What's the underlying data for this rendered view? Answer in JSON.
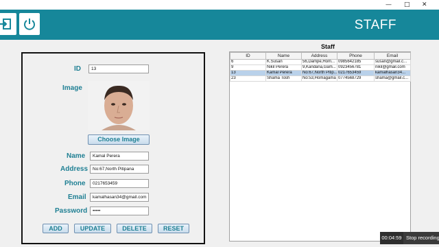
{
  "window": {
    "minimize": "—",
    "maximize": "□",
    "close": "✕"
  },
  "header": {
    "title": "STAFF"
  },
  "form": {
    "id_label": "ID",
    "id_value": "13",
    "image_label": "Image",
    "choose_image": "Choose Image",
    "name_label": "Name",
    "name_value": "Kamal Perera",
    "address_label": "Address",
    "address_value": "No:67,North Pitipana",
    "phone_label": "Phone",
    "phone_value": "0217653459",
    "email_label": "Email",
    "email_value": "kamalhasan34@gmail.com",
    "password_label": "Password",
    "password_value": "•••••"
  },
  "actions": {
    "add": "ADD",
    "update": "UPDATE",
    "delete": "DELETE",
    "reset": "RESET"
  },
  "staff": {
    "title": "Staff",
    "columns": [
      "ID",
      "Name",
      "Address",
      "Phone",
      "Email"
    ],
    "rows": [
      [
        "6",
        "K.Susan",
        "56,Dampe,Hom...",
        "0985642185",
        "susan@gmail.c..."
      ],
      [
        "9",
        "Nikil Perera",
        "9,Kandana,Gam...",
        "0923456781",
        "nikil@gmail.com"
      ],
      [
        "13",
        "Kamal Perera",
        "No:67,North Pitip...",
        "0217653459",
        "kamalhasan34..."
      ],
      [
        "23",
        "Shama Tosh",
        "No:53,Homagama",
        "0774568729",
        "shama@gmail.c..."
      ]
    ]
  },
  "recording": {
    "time": "00:04:59",
    "stop": "Stop recording"
  },
  "colors": {
    "header": "#16879a",
    "label": "#1e7f93",
    "selected_row": "#b9d1ea"
  },
  "icons": {
    "logout": "logout-icon",
    "power": "power-icon"
  }
}
